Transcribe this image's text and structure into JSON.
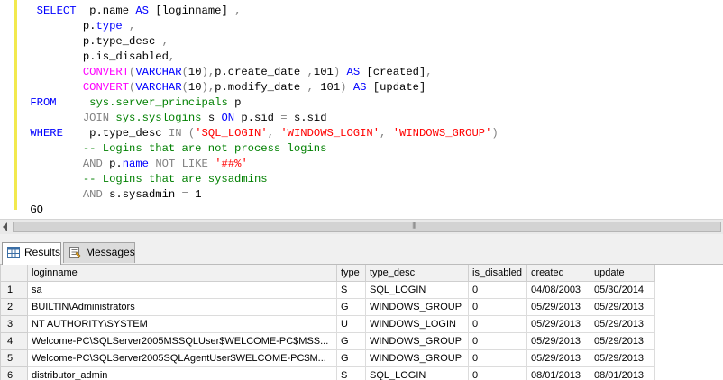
{
  "editor": {
    "lines": [
      [
        {
          "t": "  "
        },
        {
          "t": "SELECT",
          "c": "kw"
        },
        {
          "t": "  p.name "
        },
        {
          "t": "AS",
          "c": "kw"
        },
        {
          "t": " [loginname] "
        },
        {
          "t": ",",
          "c": "op"
        }
      ],
      [
        {
          "t": "         p."
        },
        {
          "t": "type",
          "c": "kw"
        },
        {
          "t": " "
        },
        {
          "t": ",",
          "c": "op"
        }
      ],
      [
        {
          "t": "         p.type_desc "
        },
        {
          "t": ",",
          "c": "op"
        }
      ],
      [
        {
          "t": "         p.is_disabled"
        },
        {
          "t": ",",
          "c": "op"
        }
      ],
      [
        {
          "t": "         "
        },
        {
          "t": "CONVERT",
          "c": "fn"
        },
        {
          "t": "(",
          "c": "op"
        },
        {
          "t": "VARCHAR",
          "c": "kw"
        },
        {
          "t": "(",
          "c": "op"
        },
        {
          "t": "10"
        },
        {
          "t": "),",
          "c": "op"
        },
        {
          "t": "p.create_date "
        },
        {
          "t": ",",
          "c": "op"
        },
        {
          "t": "101"
        },
        {
          "t": ")",
          "c": "op"
        },
        {
          "t": " "
        },
        {
          "t": "AS",
          "c": "kw"
        },
        {
          "t": " [created]"
        },
        {
          "t": ",",
          "c": "op"
        }
      ],
      [
        {
          "t": "         "
        },
        {
          "t": "CONVERT",
          "c": "fn"
        },
        {
          "t": "(",
          "c": "op"
        },
        {
          "t": "VARCHAR",
          "c": "kw"
        },
        {
          "t": "(",
          "c": "op"
        },
        {
          "t": "10"
        },
        {
          "t": "),",
          "c": "op"
        },
        {
          "t": "p.modify_date "
        },
        {
          "t": ",",
          "c": "op"
        },
        {
          "t": " 101"
        },
        {
          "t": ")",
          "c": "op"
        },
        {
          "t": " "
        },
        {
          "t": "AS",
          "c": "kw"
        },
        {
          "t": " [update]"
        }
      ],
      [
        {
          "t": " "
        },
        {
          "t": "FROM",
          "c": "kw"
        },
        {
          "t": "     "
        },
        {
          "t": "sys.server_principals",
          "c": "sys"
        },
        {
          "t": " p"
        }
      ],
      [
        {
          "t": "         "
        },
        {
          "t": "JOIN",
          "c": "op"
        },
        {
          "t": " "
        },
        {
          "t": "sys.syslogins",
          "c": "sys"
        },
        {
          "t": " s "
        },
        {
          "t": "ON",
          "c": "kw"
        },
        {
          "t": " p.sid "
        },
        {
          "t": "=",
          "c": "op"
        },
        {
          "t": " s.sid"
        }
      ],
      [
        {
          "t": " "
        },
        {
          "t": "WHERE",
          "c": "kw"
        },
        {
          "t": "    p.type_desc "
        },
        {
          "t": "IN",
          "c": "op"
        },
        {
          "t": " "
        },
        {
          "t": "(",
          "c": "op"
        },
        {
          "t": "'SQL_LOGIN'",
          "c": "str"
        },
        {
          "t": ", ",
          "c": "op"
        },
        {
          "t": "'WINDOWS_LOGIN'",
          "c": "str"
        },
        {
          "t": ", ",
          "c": "op"
        },
        {
          "t": "'WINDOWS_GROUP'",
          "c": "str"
        },
        {
          "t": ")",
          "c": "op"
        }
      ],
      [
        {
          "t": "         "
        },
        {
          "t": "-- Logins that are not process logins",
          "c": "cm"
        }
      ],
      [
        {
          "t": "         "
        },
        {
          "t": "AND",
          "c": "op"
        },
        {
          "t": " p."
        },
        {
          "t": "name",
          "c": "kw"
        },
        {
          "t": " "
        },
        {
          "t": "NOT",
          "c": "op"
        },
        {
          "t": " "
        },
        {
          "t": "LIKE",
          "c": "op"
        },
        {
          "t": " "
        },
        {
          "t": "'##%'",
          "c": "str"
        }
      ],
      [
        {
          "t": "         "
        },
        {
          "t": "-- Logins that are sysadmins",
          "c": "cm"
        }
      ],
      [
        {
          "t": "         "
        },
        {
          "t": "AND",
          "c": "op"
        },
        {
          "t": " s.sysadmin "
        },
        {
          "t": "=",
          "c": "op"
        },
        {
          "t": " 1"
        }
      ],
      [
        {
          "t": " GO"
        }
      ]
    ]
  },
  "tabs": {
    "results": "Results",
    "messages": "Messages"
  },
  "grid": {
    "columns": [
      "loginname",
      "type",
      "type_desc",
      "is_disabled",
      "created",
      "update"
    ],
    "rows": [
      [
        "1",
        "sa",
        "S",
        "SQL_LOGIN",
        "0",
        "04/08/2003",
        "05/30/2014"
      ],
      [
        "2",
        "BUILTIN\\Administrators",
        "G",
        "WINDOWS_GROUP",
        "0",
        "05/29/2013",
        "05/29/2013"
      ],
      [
        "3",
        "NT AUTHORITY\\SYSTEM",
        "U",
        "WINDOWS_LOGIN",
        "0",
        "05/29/2013",
        "05/29/2013"
      ],
      [
        "4",
        "Welcome-PC\\SQLServer2005MSSQLUser$WELCOME-PC$MSS...",
        "G",
        "WINDOWS_GROUP",
        "0",
        "05/29/2013",
        "05/29/2013"
      ],
      [
        "5",
        "Welcome-PC\\SQLServer2005SQLAgentUser$WELCOME-PC$M...",
        "G",
        "WINDOWS_GROUP",
        "0",
        "05/29/2013",
        "05/29/2013"
      ],
      [
        "6",
        "distributor_admin",
        "S",
        "SQL_LOGIN",
        "0",
        "08/01/2013",
        "08/01/2013"
      ]
    ]
  },
  "colors": {
    "keyword": "#0000ff",
    "function": "#ff00ff",
    "string": "#ff0000",
    "comment": "#008000",
    "operator": "#808080",
    "margin_bar": "#f2e94e"
  }
}
